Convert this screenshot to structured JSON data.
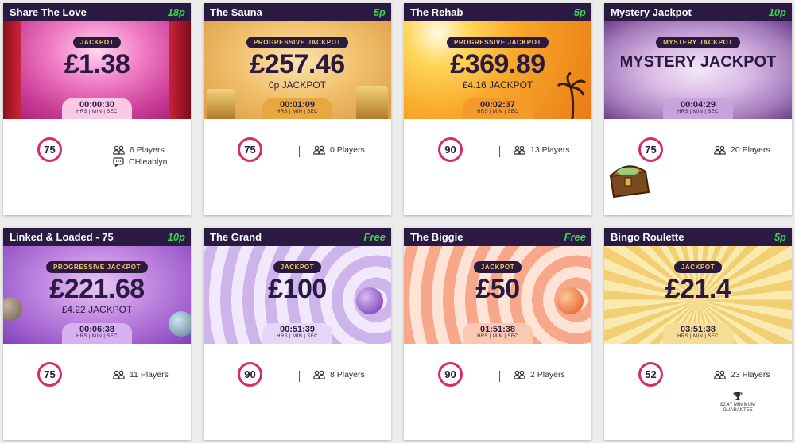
{
  "games": [
    {
      "title": "Share The Love",
      "price": "18p",
      "badge": "JACKPOT",
      "amount": "£1.38",
      "subtitle": "",
      "timer": "00:00:30",
      "timer_label": "HRS | MIN | SEC",
      "ball": "75",
      "players": "6 Players",
      "host": "CHleahlyn",
      "guarantee": ""
    },
    {
      "title": "The Sauna",
      "price": "5p",
      "badge": "PROGRESSIVE JACKPOT",
      "amount": "£257.46",
      "subtitle": "0p JACKPOT",
      "timer": "00:01:09",
      "timer_label": "HRS | MIN | SEC",
      "ball": "75",
      "players": "0 Players",
      "host": "",
      "guarantee": ""
    },
    {
      "title": "The Rehab",
      "price": "5p",
      "badge": "PROGRESSIVE JACKPOT",
      "amount": "£369.89",
      "subtitle": "£4.16 JACKPOT",
      "timer": "00:02:37",
      "timer_label": "HRS | MIN | SEC",
      "ball": "90",
      "players": "13 Players",
      "host": "",
      "guarantee": ""
    },
    {
      "title": "Mystery Jackpot",
      "price": "10p",
      "badge": "MYSTERY JACKPOT",
      "amount": "MYSTERY JACKPOT",
      "subtitle": "",
      "timer": "00:04:29",
      "timer_label": "HRS | MIN | SEC",
      "ball": "75",
      "players": "20 Players",
      "host": "",
      "guarantee": ""
    },
    {
      "title": "Linked & Loaded - 75",
      "price": "10p",
      "badge": "PROGRESSIVE JACKPOT",
      "amount": "£221.68",
      "subtitle": "£4.22 JACKPOT",
      "timer": "00:06:38",
      "timer_label": "HRS | MIN | SEC",
      "ball": "75",
      "players": "11 Players",
      "host": "",
      "guarantee": ""
    },
    {
      "title": "The Grand",
      "price": "Free",
      "badge": "JACKPOT",
      "amount": "£100",
      "subtitle": "",
      "timer": "00:51:39",
      "timer_label": "HRS | MIN | SEC",
      "ball": "90",
      "players": "8 Players",
      "host": "",
      "guarantee": ""
    },
    {
      "title": "The Biggie",
      "price": "Free",
      "badge": "JACKPOT",
      "amount": "£50",
      "subtitle": "",
      "timer": "01:51:38",
      "timer_label": "HRS | MIN | SEC",
      "ball": "90",
      "players": "2 Players",
      "host": "",
      "guarantee": ""
    },
    {
      "title": "Bingo Roulette",
      "price": "5p",
      "badge": "JACKPOT",
      "amount": "£21.4",
      "subtitle": "",
      "timer": "03:51:38",
      "timer_label": "HRS | MIN | SEC",
      "ball": "52",
      "players": "23 Players",
      "host": "",
      "guarantee": "£2.47 MINIMUM GUARANTEE"
    }
  ],
  "icons": {
    "players": "players-icon",
    "host": "host-chat-icon",
    "trophy": "trophy-icon"
  },
  "colors": {
    "header_bg": "#2a1a42",
    "price": "#39d353",
    "ball_ring": "#d62e63",
    "badge_text": "#f4c95d"
  }
}
